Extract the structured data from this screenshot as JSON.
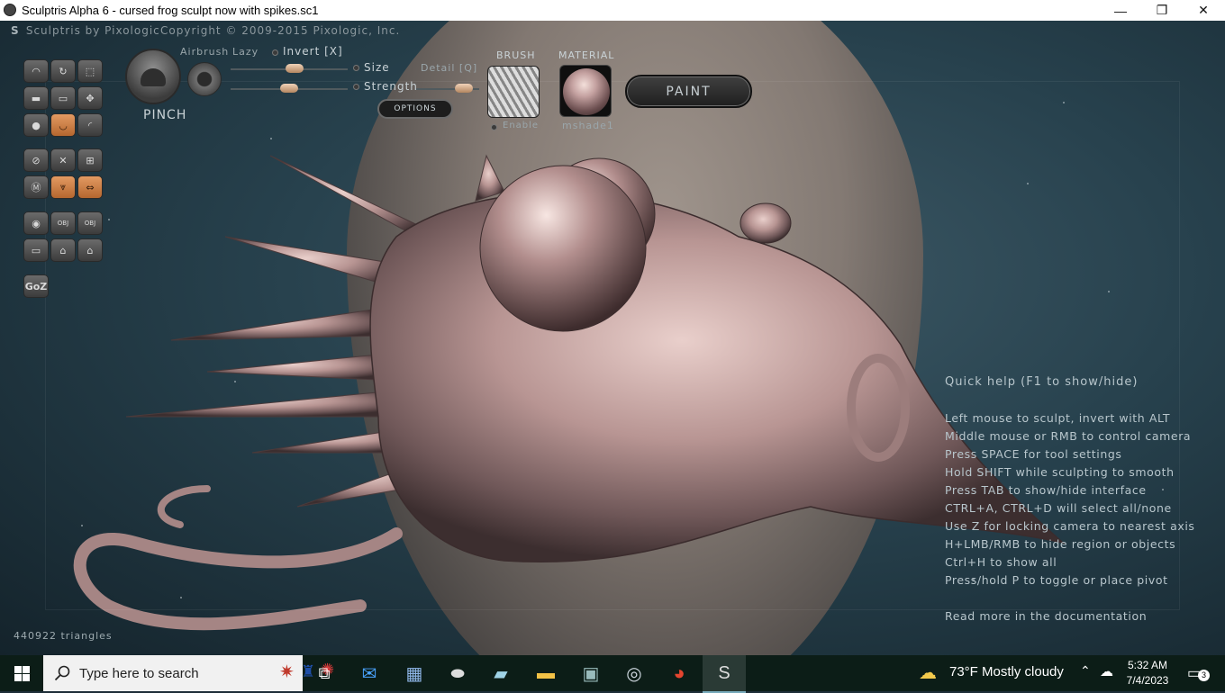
{
  "window": {
    "title": "Sculptris Alpha 6 - cursed frog sculpt now with spikes.sc1",
    "minimize_label": "—",
    "maximize_label": "❐",
    "close_label": "✕"
  },
  "header": {
    "brand": "Sculptris by Pixologic",
    "copyright": "Copyright © 2009-2015 Pixologic, Inc."
  },
  "tool_panel": {
    "goz_label": "GoZ",
    "obj_label": "OBJ",
    "active_brush_label": "PINCH",
    "airbrush_label": "Airbrush",
    "lazy_label": "Lazy",
    "invert_label": "Invert [X]",
    "size_label": "Size",
    "strength_label": "Strength",
    "detail_label": "Detail [Q]",
    "options_label": "OPTIONS",
    "size_value": 0.55,
    "strength_value": 0.5,
    "detail_value": 0.85
  },
  "brush_section": {
    "label": "BRUSH",
    "enable_label": "Enable"
  },
  "material_section": {
    "label": "MATERIAL",
    "name": "mshade1"
  },
  "paint_button": {
    "label": "PAINT"
  },
  "quick_help": {
    "title": "Quick help (F1 to show/hide)",
    "lines": [
      "Left mouse to sculpt, invert with ALT",
      "Middle mouse or RMB to control camera",
      "Press SPACE for tool settings",
      "Hold SHIFT while sculpting to smooth",
      "Press TAB to show/hide interface",
      "CTRL+A, CTRL+D will select all/none",
      "Use Z for locking camera to nearest axis",
      "H+LMB/RMB to hide region or objects",
      "Ctrl+H to show all",
      "Press/hold P to toggle or place pivot"
    ],
    "read_more": "Read more in the documentation"
  },
  "status": {
    "triangles": "440922 triangles"
  },
  "taskbar": {
    "search_placeholder": "Type here to search",
    "weather": "73°F  Mostly cloudy",
    "time": "5:32 AM",
    "date": "7/4/2023",
    "notification_count": "3"
  },
  "colors": {
    "accent_orange": "#c97a40",
    "taskbar_bg": "#0c1d17",
    "help_text": "#b8c6cc"
  }
}
